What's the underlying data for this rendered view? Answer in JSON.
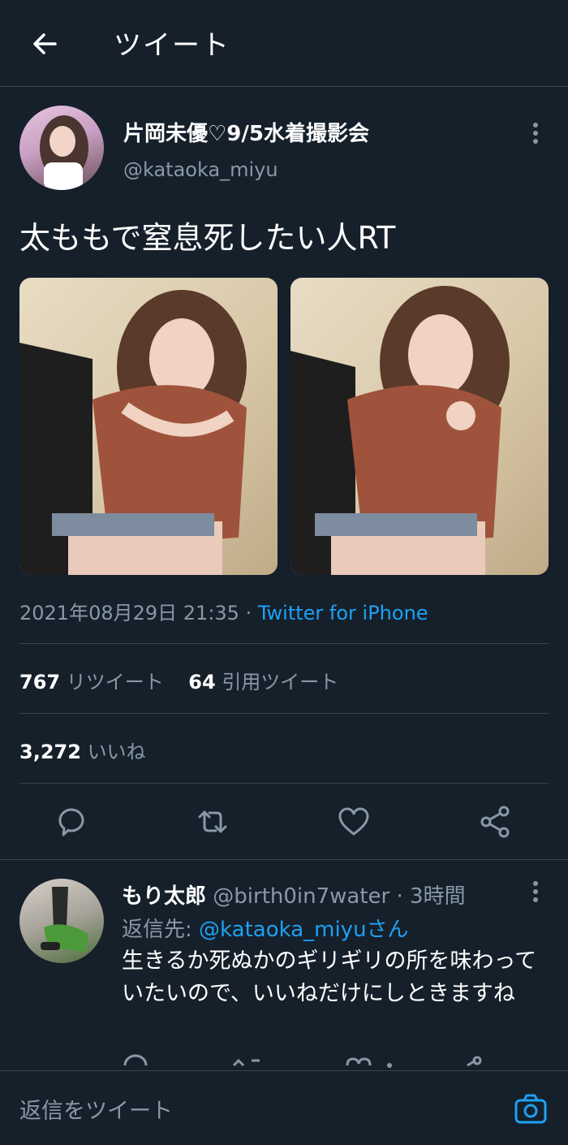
{
  "header": {
    "title": "ツイート"
  },
  "tweet": {
    "display_name": "片岡未優♡9/5水着撮影会",
    "handle": "@kataoka_miyu",
    "text": "太ももで窒息死したい人RT",
    "datetime": "2021年08月29日 21:35",
    "separator": " · ",
    "source": "Twitter for iPhone",
    "retweets_count": "767",
    "retweets_label": "リツイート",
    "quotes_count": "64",
    "quotes_label": "引用ツイート",
    "likes_count": "3,272",
    "likes_label": "いいね"
  },
  "reply": {
    "name": "もり太郎",
    "handle": "@birth0in7water",
    "dot": " · ",
    "time": "3時間",
    "replying_prefix": "返信先: ",
    "replying_to": "@kataoka_miyuさん",
    "text": "生きるか死ぬかのギリギリの所を味わっていたいので、いいねだけにしときますね"
  },
  "compose": {
    "placeholder": "返信をツイート"
  },
  "icons": {
    "back": "arrow-left-icon",
    "more": "more-vertical-icon",
    "reply": "reply-icon",
    "retweet": "retweet-icon",
    "like": "heart-icon",
    "share": "share-icon",
    "camera": "camera-icon"
  },
  "colors": {
    "background": "#15202b",
    "secondary_text": "#8899a6",
    "accent": "#1da1f2",
    "divider": "#38444d"
  }
}
